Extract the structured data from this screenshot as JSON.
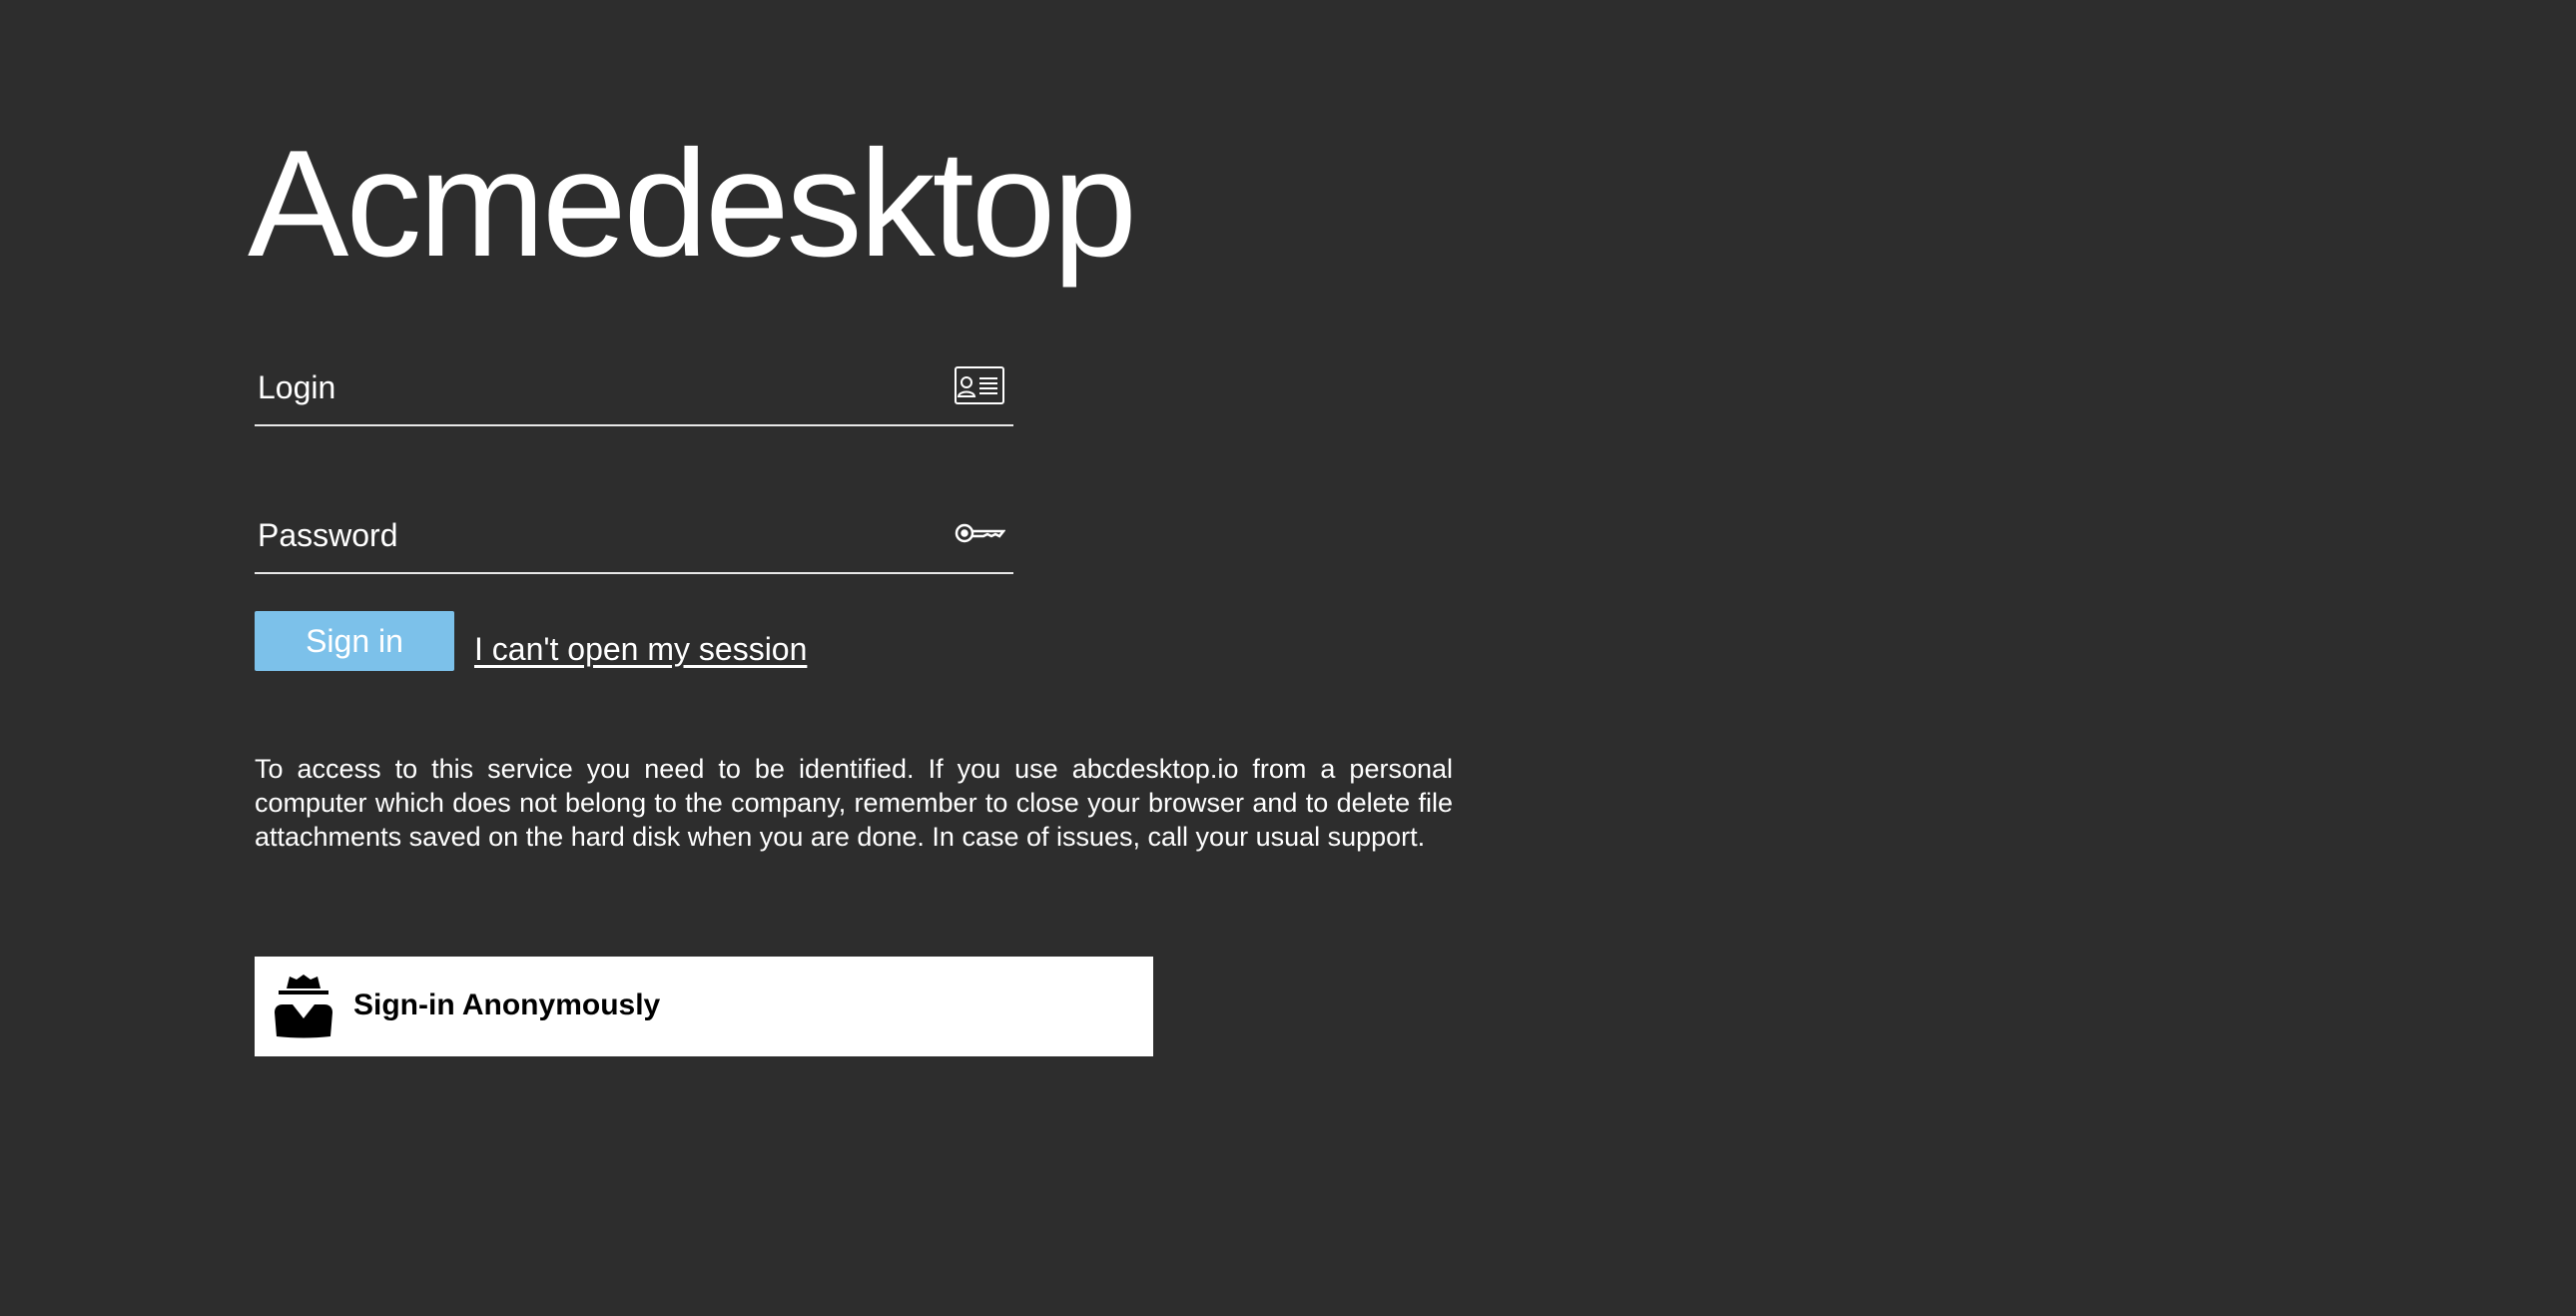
{
  "app": {
    "title": "Acmedesktop"
  },
  "login_form": {
    "login_placeholder": "Login",
    "login_value": "",
    "login_icon": "id-card-icon",
    "password_placeholder": "Password",
    "password_value": "",
    "password_icon": "key-icon",
    "signin_label": "Sign in",
    "help_link": "I can't open my session"
  },
  "notice": {
    "text": "To access to this service you need to be identified. If you use abcdesktop.io from a personal computer which does not belong to the company, remember to close your browser and to delete file attachments saved on the hard disk when you are done. In case of issues, call your usual support."
  },
  "anonymous": {
    "label": "Sign-in Anonymously",
    "icon": "incognito-icon"
  },
  "colors": {
    "background": "#2d2d2d",
    "signin_button": "#7cc1ea",
    "text": "#ffffff",
    "anonymous_button": "#ffffff"
  }
}
